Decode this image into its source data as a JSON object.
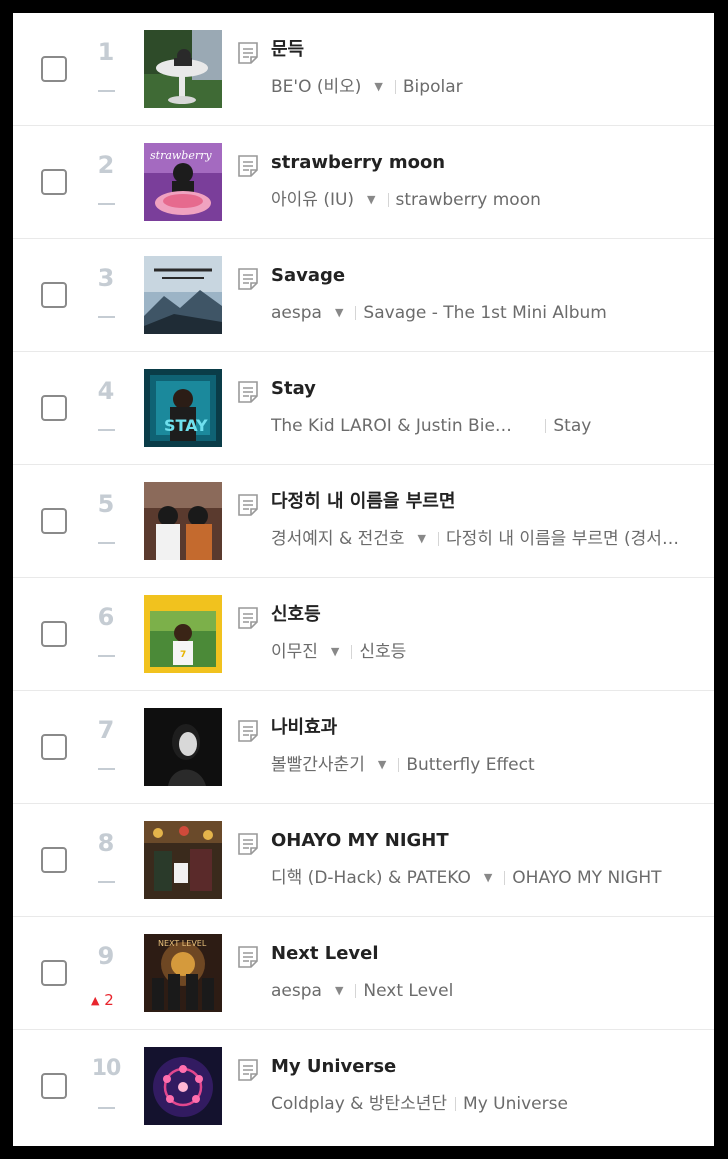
{
  "chart": {
    "rows": [
      {
        "rank": "1",
        "change": "—",
        "title": "문득",
        "artist": "BE'O (비오)",
        "album": "Bipolar",
        "art_bg": "#2e4b29",
        "art_fg": "#e9e9e9"
      },
      {
        "rank": "2",
        "change": "—",
        "title": "strawberry moon",
        "artist": "아이유 (IU)",
        "album": "strawberry moon",
        "art_bg": "#8a4aa8",
        "art_fg": "#f0a2c0"
      },
      {
        "rank": "3",
        "change": "—",
        "title": "Savage",
        "artist": "aespa",
        "album": "Savage - The 1st Mini Album",
        "art_bg": "#6a8da8",
        "art_fg": "#dfe8ef"
      },
      {
        "rank": "4",
        "change": "—",
        "title": "Stay",
        "artist": "The Kid LAROI & Justin Bie…",
        "album": "Stay",
        "art_bg": "#0d5c6e",
        "art_fg": "#41c6d8"
      },
      {
        "rank": "5",
        "change": "—",
        "title": "다정히 내 이름을 부르면",
        "artist": "경서예지 & 전건호",
        "album": "다정히 내 이름을 부르면 (경서…",
        "art_bg": "#7b4a36",
        "art_fg": "#f2f2f2"
      },
      {
        "rank": "6",
        "change": "—",
        "title": "신호등",
        "artist": "이무진",
        "album": "신호등",
        "art_bg": "#f1c21e",
        "art_fg": "#3f7a33"
      },
      {
        "rank": "7",
        "change": "—",
        "title": "나비효과",
        "artist": "볼빨간사춘기",
        "album": "Butterfly Effect",
        "art_bg": "#111111",
        "art_fg": "#d8d8d8"
      },
      {
        "rank": "8",
        "change": "—",
        "title": "OHAYO MY NIGHT",
        "artist": "디핵 (D-Hack) & PATEKO",
        "album": "OHAYO MY NIGHT",
        "art_bg": "#3a2a1c",
        "art_fg": "#e4b44b"
      },
      {
        "rank": "9",
        "change": "▲ 2",
        "title": "Next Level",
        "artist": "aespa",
        "album": "Next Level",
        "art_bg": "#2d1c14",
        "art_fg": "#d59a3c"
      },
      {
        "rank": "10",
        "change": "—",
        "title": "My Universe",
        "artist": "Coldplay & 방탄소년단",
        "album": "My Universe",
        "art_bg": "#1b1a3e",
        "art_fg": "#e2478e"
      }
    ]
  }
}
